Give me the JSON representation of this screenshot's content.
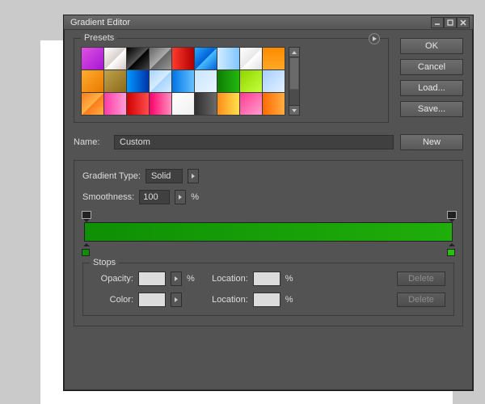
{
  "window": {
    "title": "Gradient Editor"
  },
  "presets": {
    "label": "Presets"
  },
  "buttons": {
    "ok": "OK",
    "cancel": "Cancel",
    "load": "Load...",
    "save": "Save...",
    "new": "New",
    "delete": "Delete"
  },
  "name": {
    "label": "Name:",
    "value": "Custom"
  },
  "gradientType": {
    "label": "Gradient Type:",
    "value": "Solid"
  },
  "smoothness": {
    "label": "Smoothness:",
    "value": "100",
    "unit": "%"
  },
  "gradient": {
    "stops": {
      "opacity": [
        {
          "pos": 0
        },
        {
          "pos": 100
        }
      ],
      "color": [
        {
          "pos": 0,
          "color": "#0f8f05"
        },
        {
          "pos": 100,
          "color": "#27c00c"
        }
      ]
    },
    "barCss": "linear-gradient(90deg,#0f8f05,#1fae0a)"
  },
  "stopsPanel": {
    "label": "Stops",
    "opacityLabel": "Opacity:",
    "colorLabel": "Color:",
    "locationLabel": "Location:",
    "unit": "%"
  },
  "swatches": [
    "linear-gradient(135deg,#e052e0,#a516d6)",
    "linear-gradient(135deg,#fff,#d9d0cc 50%,#fff 52%,#d0c8c2)",
    "linear-gradient(135deg,#000,#555 50%,#000 52%,#444)",
    "linear-gradient(135deg,#666,#aaa 50%,#666 52%,#999)",
    "linear-gradient(90deg,#ff3b2e,#b00000)",
    "linear-gradient(135deg,#2aa8ff,#0060d6 50%,#4abcff 52%,#0060d6)",
    "linear-gradient(90deg,#d2ecff,#7fc5ff)",
    "linear-gradient(135deg,#fff,#e8e8e8 50%,#fff 52%,#e0e0e0)",
    "linear-gradient(180deg,#ff8a00,#ffa826)",
    "linear-gradient(135deg,#ffac2e,#e97a00)",
    "linear-gradient(135deg,#bfa24a,#8c6a1a)",
    "linear-gradient(90deg,#0099ff,#0033aa)",
    "linear-gradient(135deg,#a6d4ff,#d8ecff 50%,#a6d4ff 52%,#d8ecff)",
    "linear-gradient(90deg,#0073e6,#66c2ff)",
    "linear-gradient(135deg,#c7e6ff,#eaf5ff)",
    "linear-gradient(90deg,#0e7d06,#22b80e)",
    "linear-gradient(135deg,#8fd400,#c6ff3d)",
    "linear-gradient(135deg,#a6d0ff,#e3f0ff)",
    "linear-gradient(135deg,#ff7a1a,#ffb347 50%,#ff7a1a 52%,#ffb347)",
    "linear-gradient(90deg,#ff3ba7,#ff9ed6)",
    "linear-gradient(90deg,#d00000,#ff4d4d)",
    "linear-gradient(90deg,#ff006a,#ff8fc1)",
    "linear-gradient(135deg,#fff,#f0f0f0)",
    "linear-gradient(90deg,#2e2e2e,#6b6b6b)",
    "linear-gradient(90deg,#ff8c1a,#ffe24d)",
    "linear-gradient(135deg,#ff3b91,#ff9ed0)",
    "linear-gradient(90deg,#ff6a00,#ffae42)"
  ]
}
